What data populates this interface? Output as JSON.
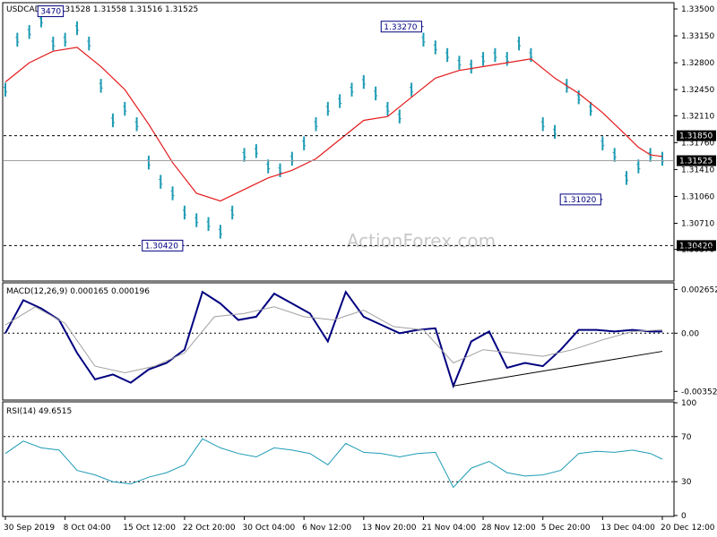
{
  "chart_data": [
    {
      "type": "line",
      "panel": "price",
      "title": "USDCAD,H4  1.31528 1.31558 1.31516 1.31525",
      "ylim": [
        1.2997,
        1.3357
      ],
      "y_ticks": [
        "1.33500",
        "1.33150",
        "1.32800",
        "1.32450",
        "1.32110",
        "1.31760",
        "1.31410",
        "1.31060",
        "1.30710",
        "1.30370"
      ],
      "current_price_label": "1.31525",
      "level_labels": [
        {
          "text": "1.31850",
          "value": 1.3185,
          "style": "dashed"
        },
        {
          "text": "1.30420",
          "value": 1.3042,
          "style": "dashed"
        }
      ],
      "annotations": [
        {
          "text": "3470",
          "value": 1.3347,
          "at": "8 Oct 04:00"
        },
        {
          "text": "1.33270",
          "value": 1.3327,
          "at": "21 Nov 04:00"
        },
        {
          "text": "1.30420",
          "value": 1.3042,
          "at": "22 Oct 20:00"
        },
        {
          "text": "1.31020",
          "value": 1.3102,
          "at": "13 Dec 04:00"
        }
      ],
      "x_ticks": [
        "30 Sep 2019",
        "8 Oct 04:00",
        "15 Oct 12:00",
        "22 Oct 20:00",
        "30 Oct 04:00",
        "6 Nov 12:00",
        "13 Nov 20:00",
        "21 Nov 04:00",
        "28 Nov 12:00",
        "5 Dec 20:00",
        "13 Dec 04:00",
        "20 Dec 12:00"
      ],
      "series": [
        {
          "style": "bars",
          "color": "#1e9bb4",
          "x": [
            0,
            4,
            8,
            12,
            16,
            20,
            24,
            28,
            32,
            36,
            40,
            44,
            48,
            52,
            56,
            60,
            64,
            68,
            72,
            76,
            80,
            84,
            88,
            92,
            96,
            100,
            104,
            108,
            112,
            116,
            120,
            124,
            128,
            132,
            136,
            140,
            144,
            148,
            152,
            156,
            160,
            164,
            168,
            172,
            176,
            180,
            184,
            188,
            192,
            196,
            200,
            204,
            208,
            212,
            216,
            220
          ],
          "y": [
            1.3245,
            1.331,
            1.332,
            1.3335,
            1.3305,
            1.331,
            1.3325,
            1.3305,
            1.325,
            1.3205,
            1.322,
            1.32,
            1.315,
            1.3125,
            1.311,
            1.3085,
            1.3075,
            1.307,
            1.306,
            1.3085,
            1.316,
            1.3165,
            1.3145,
            1.314,
            1.3155,
            1.3175,
            1.32,
            1.322,
            1.323,
            1.3245,
            1.3255,
            1.324,
            1.322,
            1.321,
            1.3245,
            1.331,
            1.33,
            1.329,
            1.328,
            1.3275,
            1.3285,
            1.329,
            1.3285,
            1.3305,
            1.329,
            1.32,
            1.319,
            1.325,
            1.3235,
            1.322,
            1.3175,
            1.316,
            1.313,
            1.3145,
            1.316,
            1.3155
          ]
        },
        {
          "style": "line",
          "color": "#e31a1c",
          "x": [
            0,
            8,
            16,
            24,
            32,
            40,
            48,
            56,
            64,
            72,
            80,
            88,
            96,
            104,
            112,
            120,
            128,
            136,
            144,
            152,
            160,
            168,
            176,
            184,
            192,
            200,
            208,
            212,
            216,
            220
          ],
          "y": [
            1.3255,
            1.328,
            1.3295,
            1.33,
            1.3275,
            1.3245,
            1.32,
            1.315,
            1.311,
            1.31,
            1.3115,
            1.313,
            1.314,
            1.3155,
            1.318,
            1.3205,
            1.321,
            1.3235,
            1.326,
            1.327,
            1.3275,
            1.328,
            1.3285,
            1.326,
            1.324,
            1.3215,
            1.3185,
            1.317,
            1.316,
            1.3158
          ]
        }
      ]
    },
    {
      "type": "line",
      "panel": "macd",
      "title": "MACD(12,26,9) 0.000165 0.000196",
      "ylim": [
        -0.004,
        0.003
      ],
      "y_ticks": [
        "0.002652",
        "0.00",
        "-0.003526"
      ],
      "series": [
        {
          "color": "#000080",
          "x": [
            0,
            6,
            12,
            18,
            24,
            30,
            36,
            42,
            48,
            54,
            60,
            66,
            72,
            78,
            84,
            90,
            96,
            102,
            108,
            114,
            120,
            126,
            132,
            138,
            144,
            150,
            156,
            162,
            168,
            174,
            180,
            186,
            192,
            198,
            204,
            210,
            216,
            220
          ],
          "y": [
            0.0,
            0.002,
            0.0015,
            0.0008,
            -0.0012,
            -0.0028,
            -0.0025,
            -0.003,
            -0.0022,
            -0.0018,
            -0.001,
            0.0025,
            0.0018,
            0.0008,
            0.001,
            0.0024,
            0.0018,
            0.0012,
            -0.0005,
            0.0025,
            0.001,
            0.0005,
            0.0,
            0.0002,
            0.0003,
            -0.0032,
            -0.0005,
            0.0001,
            -0.0021,
            -0.0018,
            -0.002,
            -0.001,
            0.0002,
            0.0002,
            0.0001,
            0.0002,
            0.0001,
            0.0001
          ]
        },
        {
          "color": "#a0a0a0",
          "x": [
            0,
            10,
            20,
            30,
            40,
            50,
            60,
            70,
            80,
            90,
            100,
            110,
            120,
            130,
            140,
            150,
            160,
            170,
            180,
            190,
            200,
            210,
            220
          ],
          "y": [
            0.0005,
            0.0016,
            0.0006,
            -0.002,
            -0.0024,
            -0.002,
            -0.0012,
            0.001,
            0.0012,
            0.0016,
            0.001,
            0.0008,
            0.0014,
            0.0004,
            0.0002,
            -0.0018,
            -0.001,
            -0.0012,
            -0.0014,
            -0.001,
            -0.0004,
            0.0001,
            0.0002
          ]
        }
      ],
      "trendline": {
        "from": [
          150,
          -0.0032
        ],
        "to": [
          220,
          -0.0011
        ]
      }
    },
    {
      "type": "line",
      "panel": "rsi",
      "title": "RSI(14) 49.6515",
      "ylim": [
        0,
        100
      ],
      "y_ticks": [
        "100",
        "70",
        "30",
        "0"
      ],
      "levels": [
        70,
        30
      ],
      "series": [
        {
          "color": "#1e9bb4",
          "x": [
            0,
            6,
            12,
            18,
            24,
            30,
            36,
            42,
            48,
            54,
            60,
            66,
            72,
            78,
            84,
            90,
            96,
            102,
            108,
            114,
            120,
            126,
            132,
            138,
            144,
            150,
            156,
            162,
            168,
            174,
            180,
            186,
            192,
            198,
            204,
            210,
            216,
            220
          ],
          "y": [
            55,
            66,
            60,
            58,
            40,
            36,
            30,
            28,
            34,
            38,
            45,
            68,
            60,
            55,
            52,
            60,
            58,
            55,
            45,
            64,
            56,
            55,
            52,
            55,
            56,
            25,
            42,
            48,
            38,
            35,
            36,
            40,
            55,
            57,
            56,
            58,
            55,
            50
          ]
        }
      ]
    }
  ],
  "watermark": "ActionForex.com"
}
